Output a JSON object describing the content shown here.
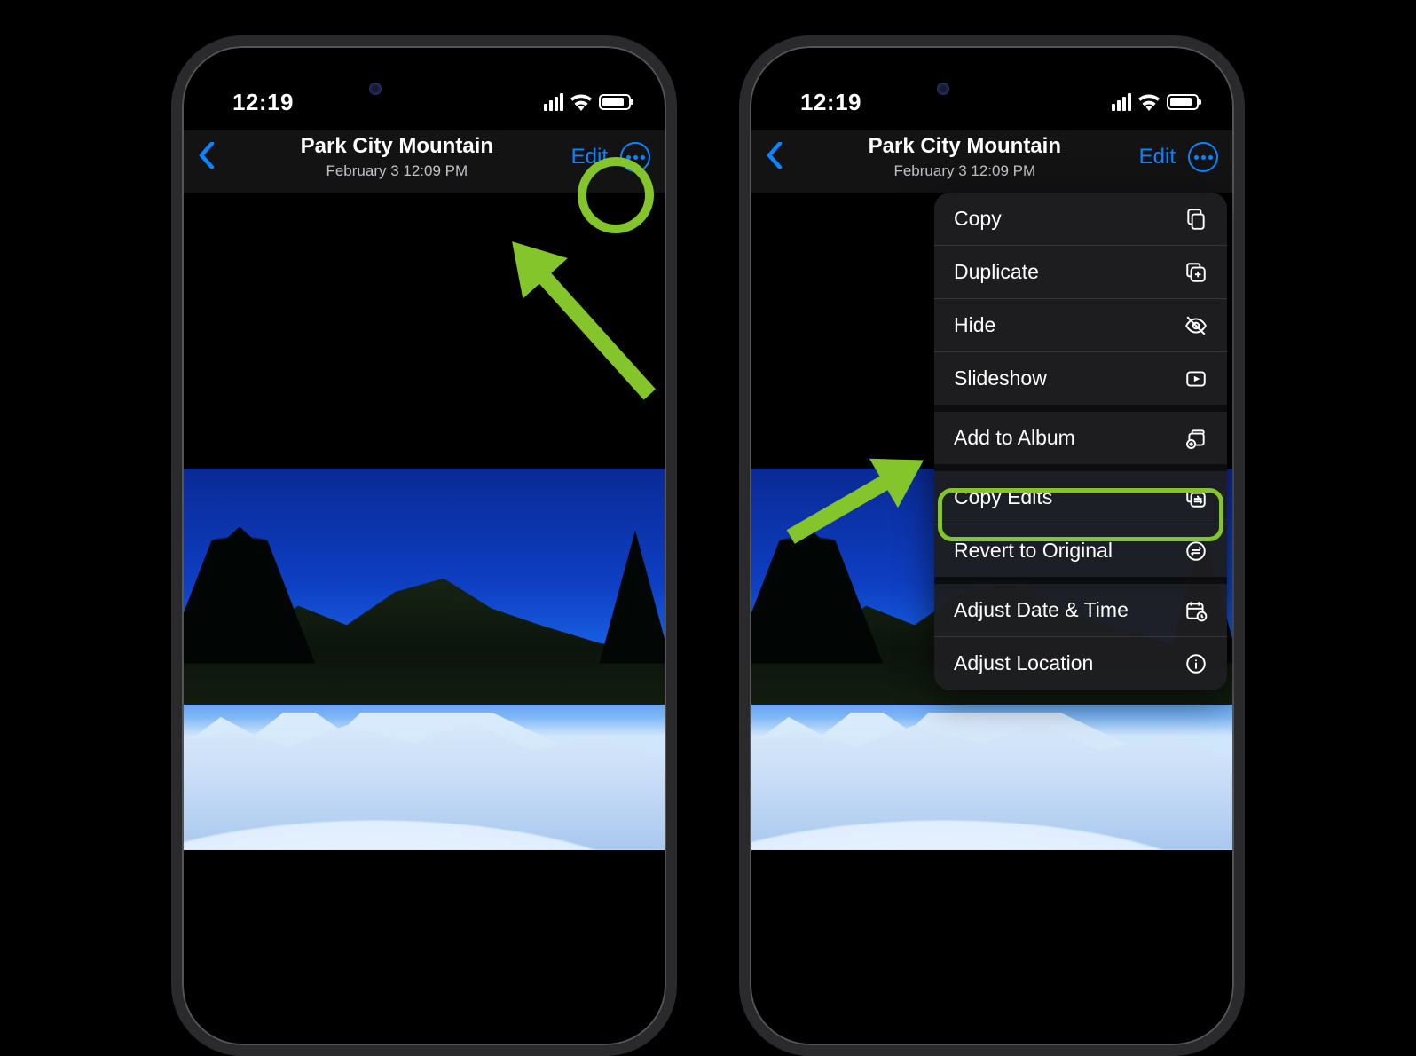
{
  "status": {
    "time": "12:19"
  },
  "nav": {
    "title": "Park City Mountain",
    "subtitle": "February 3  12:09 PM",
    "edit": "Edit"
  },
  "menu": {
    "items": [
      {
        "label": "Copy",
        "icon": "copy"
      },
      {
        "label": "Duplicate",
        "icon": "duplicate"
      },
      {
        "label": "Hide",
        "icon": "hide"
      },
      {
        "label": "Slideshow",
        "icon": "slideshow"
      },
      {
        "label": "Add to Album",
        "icon": "add-album"
      },
      {
        "label": "Copy Edits",
        "icon": "copy-edits"
      },
      {
        "label": "Revert to Original",
        "icon": "revert"
      },
      {
        "label": "Adjust Date & Time",
        "icon": "date-time"
      },
      {
        "label": "Adjust Location",
        "icon": "location"
      }
    ]
  }
}
